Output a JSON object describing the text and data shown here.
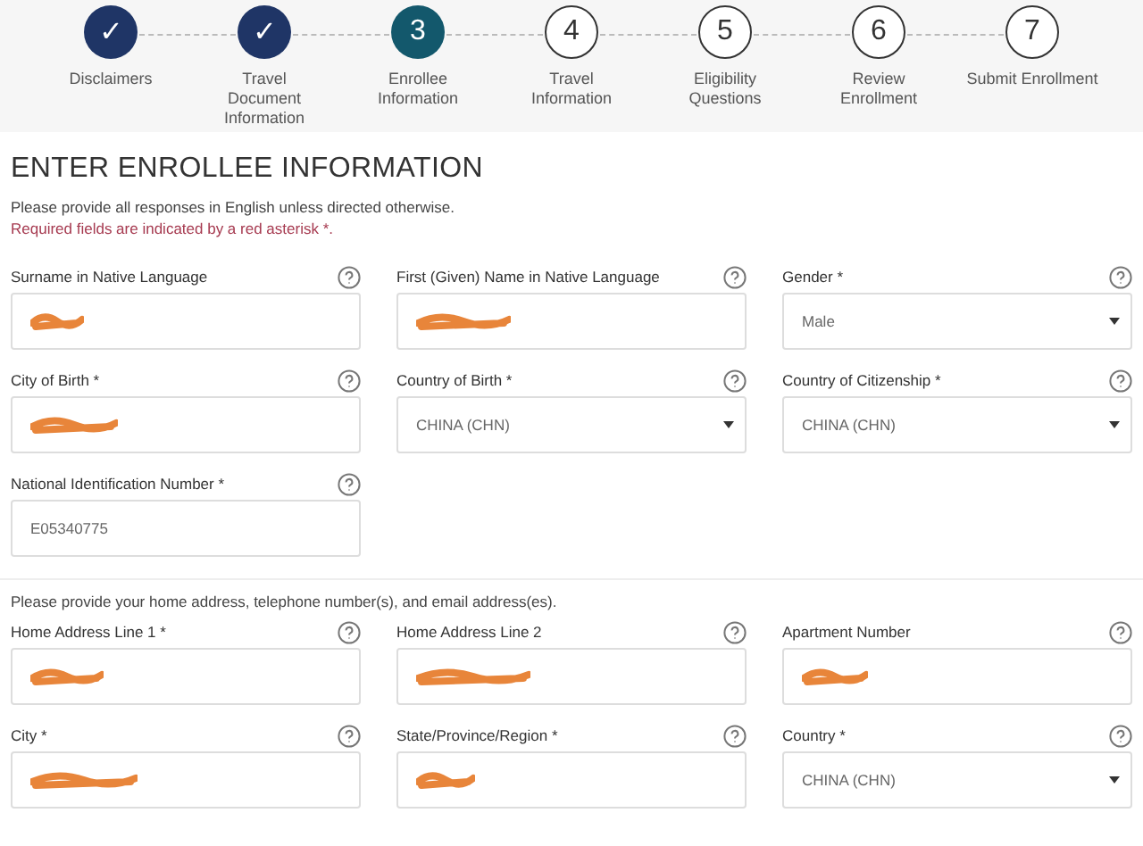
{
  "steps": [
    {
      "number": "✓",
      "label": "Disclaimers",
      "kind": "done"
    },
    {
      "number": "✓",
      "label": "Travel Document Information",
      "kind": "done"
    },
    {
      "number": "3",
      "label": "Enrollee Information",
      "kind": "current"
    },
    {
      "number": "4",
      "label": "Travel Information",
      "kind": "todo"
    },
    {
      "number": "5",
      "label": "Eligibility Questions",
      "kind": "todo"
    },
    {
      "number": "6",
      "label": "Review Enrollment",
      "kind": "todo"
    },
    {
      "number": "7",
      "label": "Submit Enrollment",
      "kind": "todo"
    }
  ],
  "heading": "ENTER ENROLLEE INFORMATION",
  "intro": "Please provide all responses in English unless directed otherwise.",
  "required_note": "Required fields are indicated by a red asterisk *.",
  "sections": [
    {
      "fields": [
        {
          "label": "Surname in Native Language",
          "kind": "text",
          "redacted": true
        },
        {
          "label": "First (Given) Name in Native Language",
          "kind": "text",
          "redacted": true
        },
        {
          "label": "Gender *",
          "kind": "select",
          "value": "Male"
        },
        {
          "label": "City of Birth *",
          "kind": "text",
          "redacted": true
        },
        {
          "label": "Country of Birth *",
          "kind": "select",
          "value": "CHINA (CHN)"
        },
        {
          "label": "Country of Citizenship *",
          "kind": "select",
          "value": "CHINA (CHN)"
        },
        {
          "label": "National Identification Number *",
          "kind": "text",
          "value": "E05340775"
        }
      ]
    },
    {
      "note": "Please provide your home address, telephone number(s), and email address(es).",
      "fields": [
        {
          "label": "Home Address Line 1 *",
          "kind": "text",
          "redacted": true
        },
        {
          "label": "Home Address Line 2",
          "kind": "text",
          "redacted": true
        },
        {
          "label": "Apartment Number",
          "kind": "text",
          "redacted": true
        },
        {
          "label": "City *",
          "kind": "text",
          "redacted": true
        },
        {
          "label": "State/Province/Region *",
          "kind": "text",
          "redacted": true
        },
        {
          "label": "Country *",
          "kind": "select",
          "value": "CHINA (CHN)"
        }
      ]
    }
  ]
}
